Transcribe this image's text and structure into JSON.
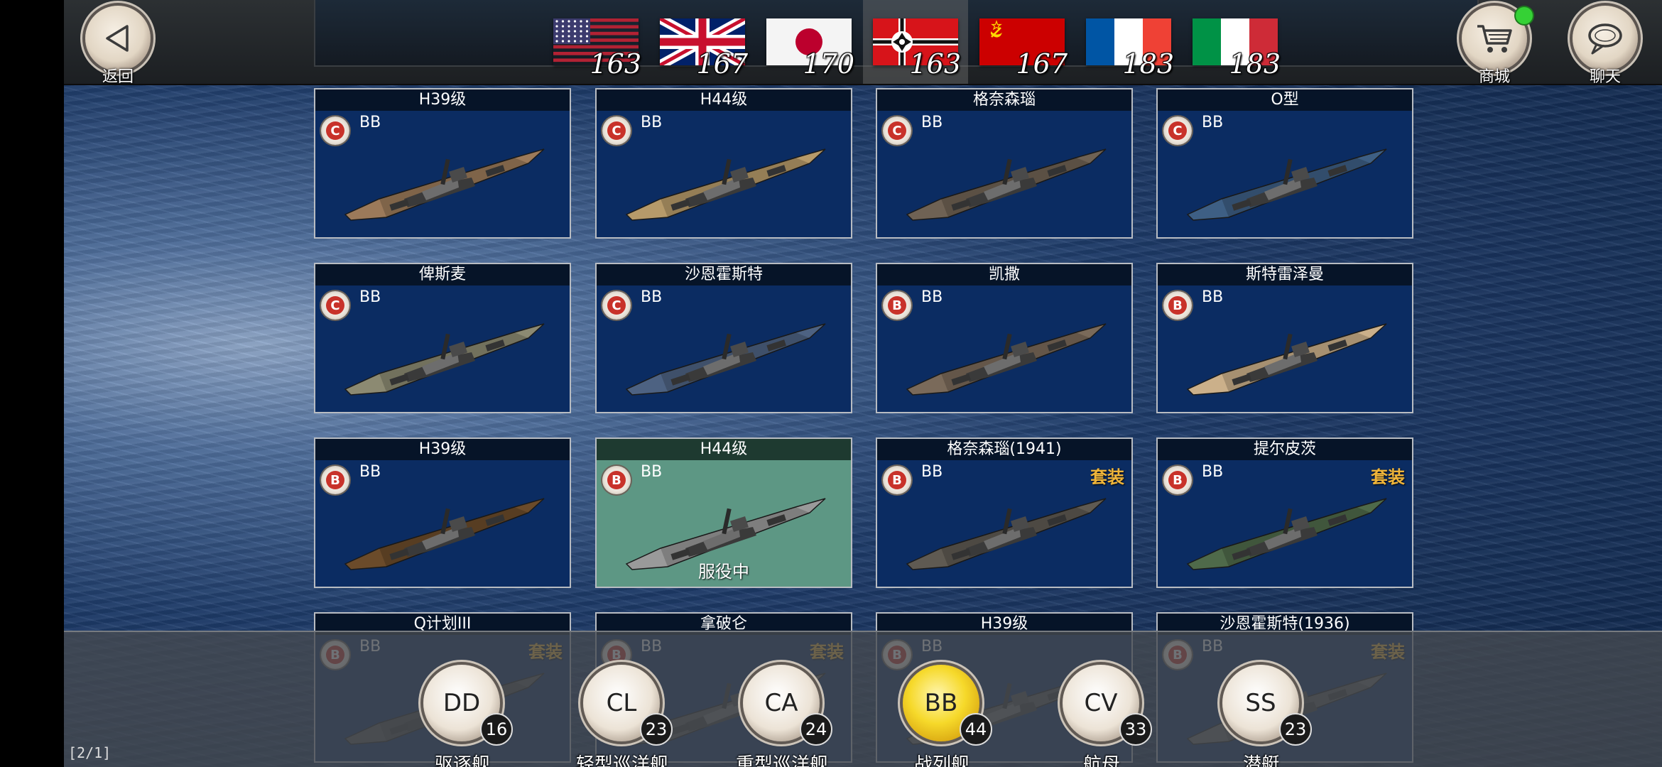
{
  "header": {
    "back_label": "返回",
    "shop_label": "商城",
    "chat_label": "聊天"
  },
  "nations": [
    {
      "flag": "usa-flag-icon",
      "count": "163"
    },
    {
      "flag": "uk-flag-icon",
      "count": "167"
    },
    {
      "flag": "japan-flag-icon",
      "count": "170"
    },
    {
      "flag": "germany-flag-icon",
      "count": "163",
      "active": true
    },
    {
      "flag": "ussr-flag-icon",
      "count": "167"
    },
    {
      "flag": "france-flag-icon",
      "count": "183"
    },
    {
      "flag": "italy-flag-icon",
      "count": "183"
    }
  ],
  "ships": [
    {
      "name": "H39级",
      "rank": "C",
      "type": "BB",
      "set": "",
      "status": ""
    },
    {
      "name": "H44级",
      "rank": "C",
      "type": "BB",
      "set": "",
      "status": ""
    },
    {
      "name": "格奈森瑙",
      "rank": "C",
      "type": "BB",
      "set": "",
      "status": ""
    },
    {
      "name": "O型",
      "rank": "C",
      "type": "BB",
      "set": "",
      "status": ""
    },
    {
      "name": "俾斯麦",
      "rank": "C",
      "type": "BB",
      "set": "",
      "status": ""
    },
    {
      "name": "沙恩霍斯特",
      "rank": "C",
      "type": "BB",
      "set": "",
      "status": ""
    },
    {
      "name": "凯撒",
      "rank": "B",
      "type": "BB",
      "set": "",
      "status": ""
    },
    {
      "name": "斯特雷泽曼",
      "rank": "B",
      "type": "BB",
      "set": "",
      "status": ""
    },
    {
      "name": "H39级",
      "rank": "B",
      "type": "BB",
      "set": "",
      "status": ""
    },
    {
      "name": "H44级",
      "rank": "B",
      "type": "BB",
      "set": "",
      "status": "服役中"
    },
    {
      "name": "格奈森瑙(1941)",
      "rank": "B",
      "type": "BB",
      "set": "套装",
      "status": ""
    },
    {
      "name": "提尔皮茨",
      "rank": "B",
      "type": "BB",
      "set": "套装",
      "status": ""
    },
    {
      "name": "Q计划III",
      "rank": "B",
      "type": "BB",
      "set": "套装",
      "status": ""
    },
    {
      "name": "拿破仑",
      "rank": "B",
      "type": "BB",
      "set": "套装",
      "status": ""
    },
    {
      "name": "H39级",
      "rank": "B",
      "type": "BB",
      "set": "",
      "status": ""
    },
    {
      "name": "沙恩霍斯特(1936)",
      "rank": "B",
      "type": "BB",
      "set": "套装",
      "status": ""
    }
  ],
  "ship_types": [
    {
      "code": "DD",
      "count": "16",
      "name": "驱逐舰"
    },
    {
      "code": "CL",
      "count": "23",
      "name": "轻型巡洋舰"
    },
    {
      "code": "CA",
      "count": "24",
      "name": "重型巡洋舰"
    },
    {
      "code": "BB",
      "count": "44",
      "name": "战列舰",
      "selected": true
    },
    {
      "code": "CV",
      "count": "33",
      "name": "航母"
    },
    {
      "code": "SS",
      "count": "23",
      "name": "潜艇"
    }
  ],
  "page_indicator": "[2/1]",
  "colors": {
    "card_bg": "#0b2c62",
    "active_card_bg": "#5d9784",
    "rank_red": "#c8322a",
    "set_gold": "#f0b53a",
    "selected_type": "#f6d92a",
    "notification_green": "#35d135"
  }
}
